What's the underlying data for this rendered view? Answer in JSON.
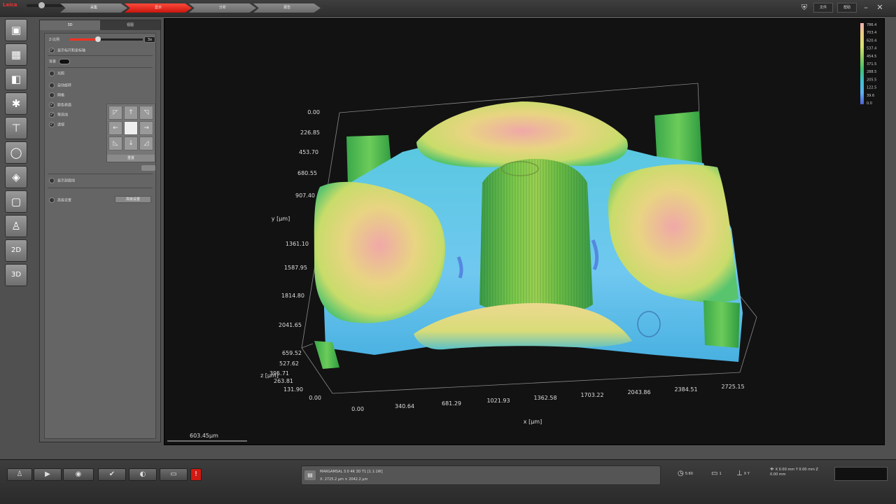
{
  "topbar": {
    "brand": "Leica",
    "progress": 0.35,
    "steps": [
      "采集",
      "显示",
      "分析",
      "报告"
    ],
    "active_step": 1,
    "buttons": [
      "文件",
      "帮助"
    ],
    "icons": [
      "shield-icon",
      "minimize-icon",
      "close-icon"
    ]
  },
  "left_tools": [
    {
      "name": "tool-live-image",
      "glyph": "▣"
    },
    {
      "name": "tool-snapshot",
      "glyph": "▦"
    },
    {
      "name": "tool-image-stack",
      "glyph": "◧"
    },
    {
      "name": "tool-illumination",
      "glyph": "✱"
    },
    {
      "name": "tool-measure",
      "glyph": "⊤"
    },
    {
      "name": "tool-circle",
      "glyph": "◯"
    },
    {
      "name": "tool-layers",
      "glyph": "◈"
    },
    {
      "name": "tool-panel",
      "glyph": "▢"
    },
    {
      "name": "tool-person",
      "glyph": "♙"
    },
    {
      "name": "tool-2d",
      "glyph": "2D"
    },
    {
      "name": "tool-3d",
      "glyph": "3D"
    }
  ],
  "panel": {
    "tabs": [
      "3D",
      "视图"
    ],
    "active_tab": 0,
    "scale_label": "Z-比例",
    "scale_value_text": "3x",
    "scale_fraction": 0.38,
    "options": [
      {
        "label": "显示标尺和坐标轴",
        "checked": true
      },
      {
        "label": "背景",
        "checked": false,
        "swatch": "#111111"
      },
      {
        "label": "光照",
        "checked": false
      },
      {
        "label": "自动旋转",
        "checked": false
      },
      {
        "label": "网格",
        "checked": false
      },
      {
        "label": "颜色表面",
        "checked": true
      },
      {
        "label": "等高线",
        "checked": true
      },
      {
        "label": "透视",
        "checked": true
      },
      {
        "label": "显示剖面线",
        "checked": false
      },
      {
        "label": "高级设置",
        "checked": false
      }
    ],
    "pad_reset": "重置",
    "settings_button": "高级设置"
  },
  "viewport": {
    "scale_bar": "603.45µm",
    "colorbar": {
      "colors": [
        "#f0b0b0",
        "#e8d080",
        "#d8e070",
        "#90cc60",
        "#40c070",
        "#40c0d0",
        "#60b0f0",
        "#5060d0"
      ],
      "labels": [
        "786.4",
        "703.4",
        "620.4",
        "537.4",
        "454.5",
        "371.5",
        "288.5",
        "205.5",
        "122.5",
        "39.6",
        "0.0"
      ]
    }
  },
  "chart_data": {
    "type": "surface3d",
    "x_axis": {
      "label": "x [µm]",
      "ticks": [
        "0.00",
        "340.64",
        "681.29",
        "1021.93",
        "1362.58",
        "1703.22",
        "2043.86",
        "2384.51",
        "2725.15"
      ]
    },
    "y_axis": {
      "label": "y [µm]",
      "ticks": [
        "0.00",
        "226.85",
        "453.70",
        "680.55",
        "907.40",
        "1361.10",
        "1587.95",
        "1814.80",
        "2041.65"
      ]
    },
    "z_axis": {
      "label": "z [µm]",
      "ticks": [
        "659.52",
        "527.62",
        "395.71",
        "263.81",
        "131.90",
        "0.00"
      ]
    }
  },
  "bottombar": {
    "info_line1": "MARGAMSAL 3.0 4K 3D T1 [1.1:1W]",
    "info_line2": "X: 2725.2 µm × 2042.2 µm",
    "status": [
      {
        "icon": "clock-icon",
        "text": "5:60"
      },
      {
        "icon": "monitor-icon",
        "text": "1"
      },
      {
        "icon": "stage-icon",
        "text": "X Y"
      },
      {
        "icon": "coordinates-icon",
        "text": "X 0.00 mm Y 0.00 mm Z 0.00 mm"
      }
    ]
  }
}
